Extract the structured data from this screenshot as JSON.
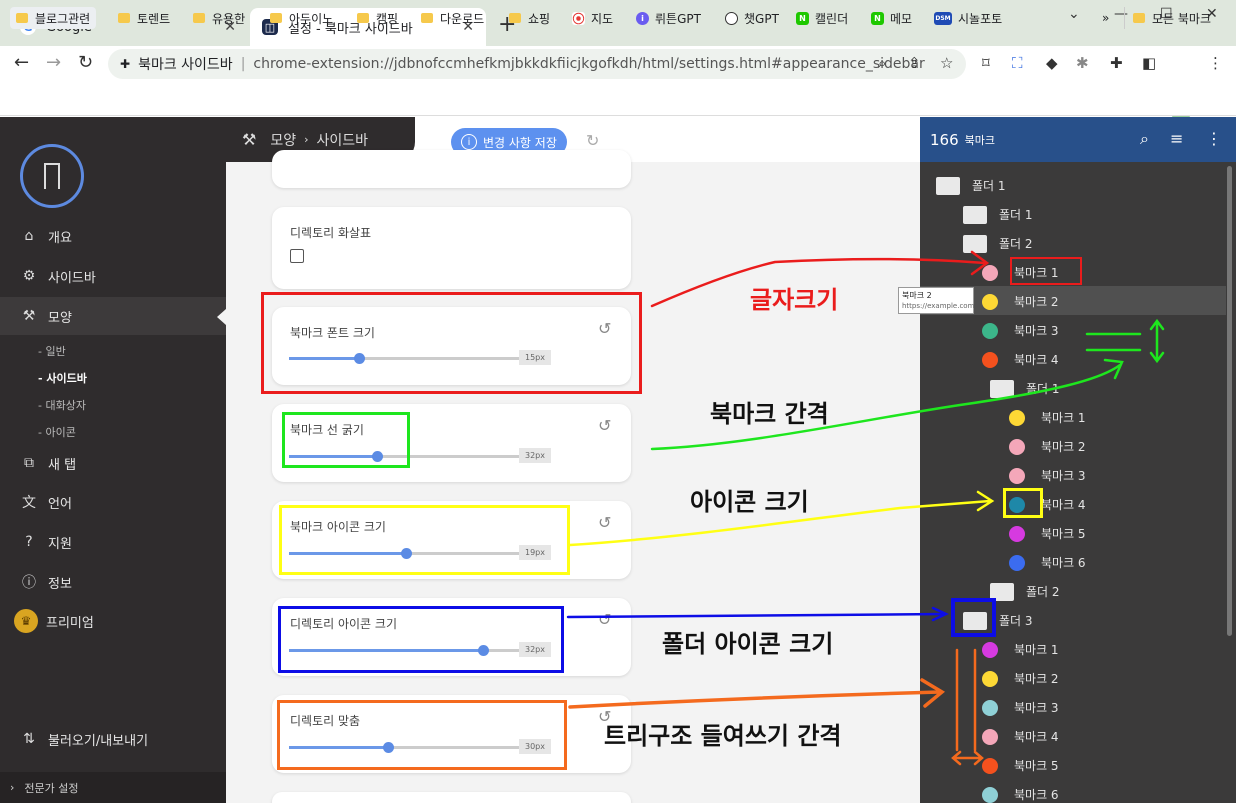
{
  "tabs": [
    {
      "title": "Google",
      "fav": "G",
      "fav_color": "#4285f4"
    },
    {
      "title": "설정 - 북마크 사이드바",
      "fav": "◫",
      "fav_color": "#1c2a4c"
    }
  ],
  "omnibox": {
    "site": "북마크 사이드바",
    "url": "chrome-extension://jdbnofccmhefkmjbkkdkfiicjkgofkdh/html/settings.html#appearance_sidebar"
  },
  "bookmarks_bar": [
    {
      "label": "블로그관련",
      "icon": "folder"
    },
    {
      "label": "토렌트",
      "icon": "folder"
    },
    {
      "label": "유용한",
      "icon": "folder"
    },
    {
      "label": "아두이노",
      "icon": "folder"
    },
    {
      "label": "캠핑",
      "icon": "folder"
    },
    {
      "label": "다운로드",
      "icon": "folder"
    },
    {
      "label": "쇼핑",
      "icon": "folder"
    },
    {
      "label": "지도",
      "icon": "maps"
    },
    {
      "label": "뤼튼GPT",
      "icon": "wrtn"
    },
    {
      "label": "챗GPT",
      "icon": "chatgpt"
    },
    {
      "label": "캘린더",
      "icon": "naver"
    },
    {
      "label": "메모",
      "icon": "naver"
    },
    {
      "label": "시놀포토",
      "icon": "dsm",
      "badge": "DSM"
    }
  ],
  "bookmarks_bar_more": "»",
  "bookmarks_bar_all": "모든 북마크",
  "nav": {
    "items": [
      {
        "label": "개요",
        "icon": "home-icon"
      },
      {
        "label": "사이드바",
        "icon": "gear-icon"
      },
      {
        "label": "모양",
        "icon": "paint-roller-icon"
      },
      {
        "label": "새 탭",
        "icon": "new-tab-icon"
      },
      {
        "label": "언어",
        "icon": "translate-icon"
      },
      {
        "label": "지원",
        "icon": "help-icon"
      },
      {
        "label": "정보",
        "icon": "info-icon"
      },
      {
        "label": "프리미엄",
        "icon": "crown-icon"
      }
    ],
    "sub": [
      "- 일반",
      "- 사이드바",
      "- 대화상자",
      "- 아이콘"
    ],
    "import_export": "불러오기/내보내기",
    "expert": "전문가 설정"
  },
  "header": {
    "section": "모양",
    "page": "사이드바",
    "arrow": "›"
  },
  "save_button": "변경 사항 저장",
  "settings": {
    "dir_arrow": "디렉토리 화살표",
    "sliders": [
      {
        "label": "북마크 폰트 크기",
        "value": "15px",
        "fraction": 0.32
      },
      {
        "label": "북마크 선 굵기",
        "value": "32px",
        "fraction": 0.4
      },
      {
        "label": "북마크 아이콘 크기",
        "value": "19px",
        "fraction": 0.53
      },
      {
        "label": "디렉토리 아이콘 크기",
        "value": "32px",
        "fraction": 0.88
      },
      {
        "label": "디렉토리 맞춤",
        "value": "30px",
        "fraction": 0.45
      }
    ]
  },
  "panel": {
    "count": "166",
    "label": "북마크",
    "tree": [
      {
        "t": "f",
        "label": "폴더 1",
        "lvl": 0
      },
      {
        "t": "f",
        "label": "폴더 1",
        "lvl": 1
      },
      {
        "t": "f",
        "label": "폴더 2",
        "lvl": 1
      },
      {
        "t": "b",
        "label": "북마크 1",
        "lvl": 2,
        "c": "#f4a7b9"
      },
      {
        "t": "b",
        "label": "북마크 2",
        "lvl": 2,
        "c": "#fdd835"
      },
      {
        "t": "b",
        "label": "북마크 3",
        "lvl": 2,
        "c": "#3cb68a"
      },
      {
        "t": "b",
        "label": "북마크 4",
        "lvl": 2,
        "c": "#f4511e"
      },
      {
        "t": "f",
        "label": "폴더 1",
        "lvl": 2
      },
      {
        "t": "b",
        "label": "북마크 1",
        "lvl": 3,
        "c": "#fdd835"
      },
      {
        "t": "b",
        "label": "북마크 2",
        "lvl": 3,
        "c": "#f4a7b9"
      },
      {
        "t": "b",
        "label": "북마크 3",
        "lvl": 3,
        "c": "#f4a7b9"
      },
      {
        "t": "b",
        "label": "북마크 4",
        "lvl": 3,
        "c": "#1e88a8"
      },
      {
        "t": "b",
        "label": "북마크 5",
        "lvl": 3,
        "c": "#d63ae0"
      },
      {
        "t": "b",
        "label": "북마크 6",
        "lvl": 3,
        "c": "#3b6cf0"
      },
      {
        "t": "f",
        "label": "폴더 2",
        "lvl": 2
      },
      {
        "t": "f",
        "label": "폴더 3",
        "lvl": 1
      },
      {
        "t": "b",
        "label": "북마크 1",
        "lvl": 2,
        "c": "#d63ae0"
      },
      {
        "t": "b",
        "label": "북마크 2",
        "lvl": 2,
        "c": "#fdd835"
      },
      {
        "t": "b",
        "label": "북마크 3",
        "lvl": 2,
        "c": "#8fd0d6"
      },
      {
        "t": "b",
        "label": "북마크 4",
        "lvl": 2,
        "c": "#f4a7b9"
      },
      {
        "t": "b",
        "label": "북마크 5",
        "lvl": 2,
        "c": "#f4511e"
      },
      {
        "t": "b",
        "label": "북마크 6",
        "lvl": 2,
        "c": "#8fd0d6"
      }
    ],
    "tooltip": {
      "title": "북마크 2",
      "url": "https://example.com"
    }
  },
  "annotations": {
    "font_size": "글자크기",
    "spacing": "북마크 간격",
    "icon_size": "아이콘 크기",
    "folder_icon": "폴더 아이콘 크기",
    "indent": "트리구조 들여쓰기 간격"
  },
  "colors": {
    "red": "#ea1c1c",
    "green": "#1ee61e",
    "yellow": "#ffff14",
    "blue": "#0d0de6",
    "orange": "#f46a1e",
    "accent": "#5d91ef",
    "panel_head": "#28508a"
  }
}
